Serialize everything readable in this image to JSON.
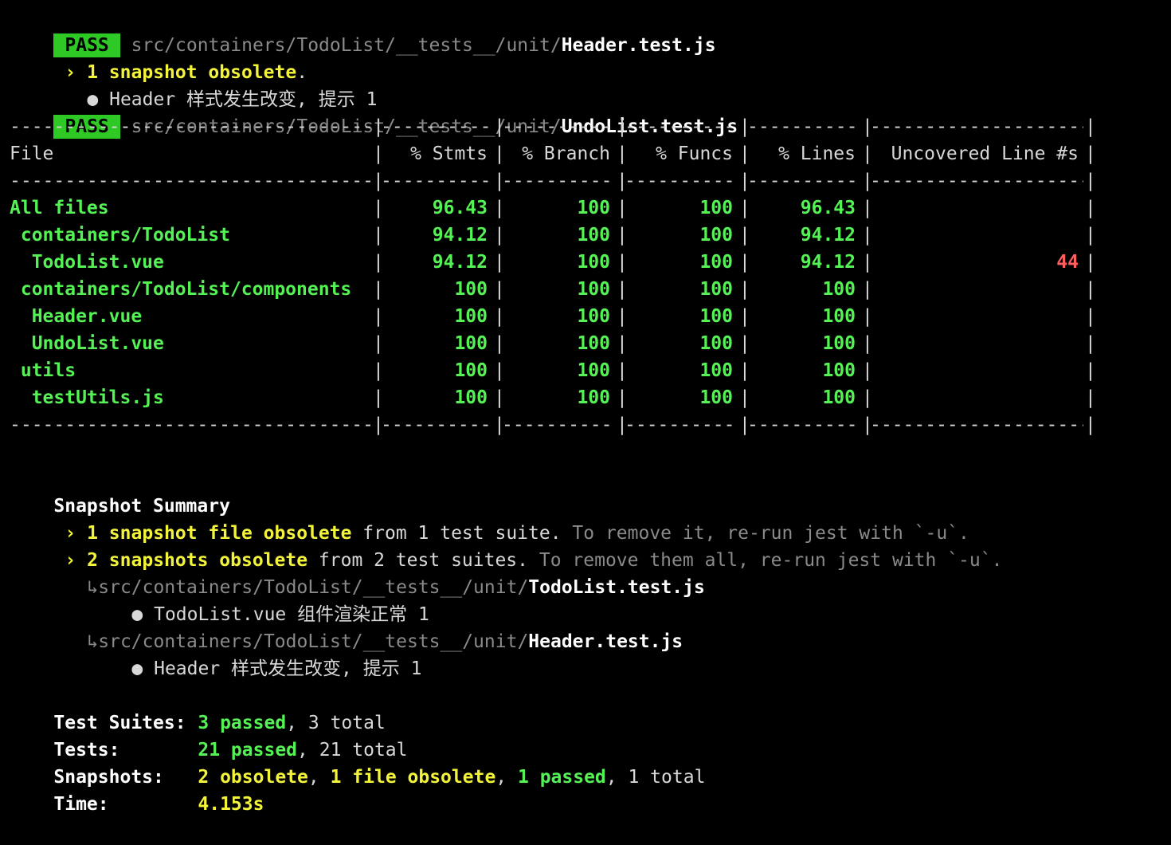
{
  "pass1": {
    "badge": "PASS",
    "path_dim": "src/containers/TodoList/__tests__/unit/",
    "file": "Header.test.js"
  },
  "obsolete_line": {
    "arrow": "›",
    "text": "1 snapshot obsolete",
    "tail": "."
  },
  "bullet_line1": {
    "bullet": "●",
    "text": "Header 样式发生改变, 提示 1"
  },
  "pass2": {
    "badge": "PASS",
    "path_dim": "src/containers/TodoList/__tests__/unit/",
    "file": "UndoList.test.js"
  },
  "coverage": {
    "headers": [
      "File",
      "% Stmts",
      "% Branch",
      "% Funcs",
      "% Lines",
      "Uncovered Line #s"
    ],
    "rows": [
      {
        "file": "All files",
        "stmts": "96.43",
        "branch": "100",
        "funcs": "100",
        "lines": "96.43",
        "uncovered": ""
      },
      {
        "file": " containers/TodoList",
        "stmts": "94.12",
        "branch": "100",
        "funcs": "100",
        "lines": "94.12",
        "uncovered": ""
      },
      {
        "file": "  TodoList.vue",
        "stmts": "94.12",
        "branch": "100",
        "funcs": "100",
        "lines": "94.12",
        "uncovered": "44"
      },
      {
        "file": " containers/TodoList/components",
        "stmts": "100",
        "branch": "100",
        "funcs": "100",
        "lines": "100",
        "uncovered": ""
      },
      {
        "file": "  Header.vue",
        "stmts": "100",
        "branch": "100",
        "funcs": "100",
        "lines": "100",
        "uncovered": ""
      },
      {
        "file": "  UndoList.vue",
        "stmts": "100",
        "branch": "100",
        "funcs": "100",
        "lines": "100",
        "uncovered": ""
      },
      {
        "file": " utils",
        "stmts": "100",
        "branch": "100",
        "funcs": "100",
        "lines": "100",
        "uncovered": ""
      },
      {
        "file": "  testUtils.js",
        "stmts": "100",
        "branch": "100",
        "funcs": "100",
        "lines": "100",
        "uncovered": ""
      }
    ]
  },
  "snapshot_summary": {
    "title": "Snapshot Summary",
    "line1": {
      "arrow": "›",
      "highlight": "1 snapshot file obsolete",
      "rest": " from 1 test suite.",
      "hint": " To remove it, re-run jest with `-u`."
    },
    "line2": {
      "arrow": "›",
      "highlight": "2 snapshots obsolete",
      "rest": " from 2 test suites.",
      "hint": " To remove them all, re-run jest with `-u`."
    },
    "item1": {
      "arrow": "↳",
      "path_dim": "src/containers/TodoList/__tests__/unit/",
      "file": "TodoList.test.js",
      "bullet": "●",
      "desc": "TodoList.vue 组件渲染正常 1"
    },
    "item2": {
      "arrow": "↳",
      "path_dim": "src/containers/TodoList/__tests__/unit/",
      "file": "Header.test.js",
      "bullet": "●",
      "desc": "Header 样式发生改变, 提示 1"
    }
  },
  "results": {
    "suites": {
      "label": "Test Suites:",
      "passed": "3 passed",
      "sep": ", ",
      "total": "3 total"
    },
    "tests": {
      "label": "Tests:",
      "passed": "21 passed",
      "sep": ", ",
      "total": "21 total"
    },
    "snapshots": {
      "label": "Snapshots:",
      "obsolete": "2 obsolete",
      "sep1": ", ",
      "file_obsolete": "1 file obsolete",
      "sep2": ", ",
      "passed": "1 passed",
      "sep3": ", ",
      "total": "1 total"
    },
    "time": {
      "label": "Time:",
      "value": "4.153s"
    }
  },
  "colors": {
    "pass_bg": "#2fc926",
    "green": "#54f254",
    "yellow": "#f3f33a",
    "red": "#ff5f5f",
    "dim": "#8a8a8a",
    "background": "#000000"
  }
}
